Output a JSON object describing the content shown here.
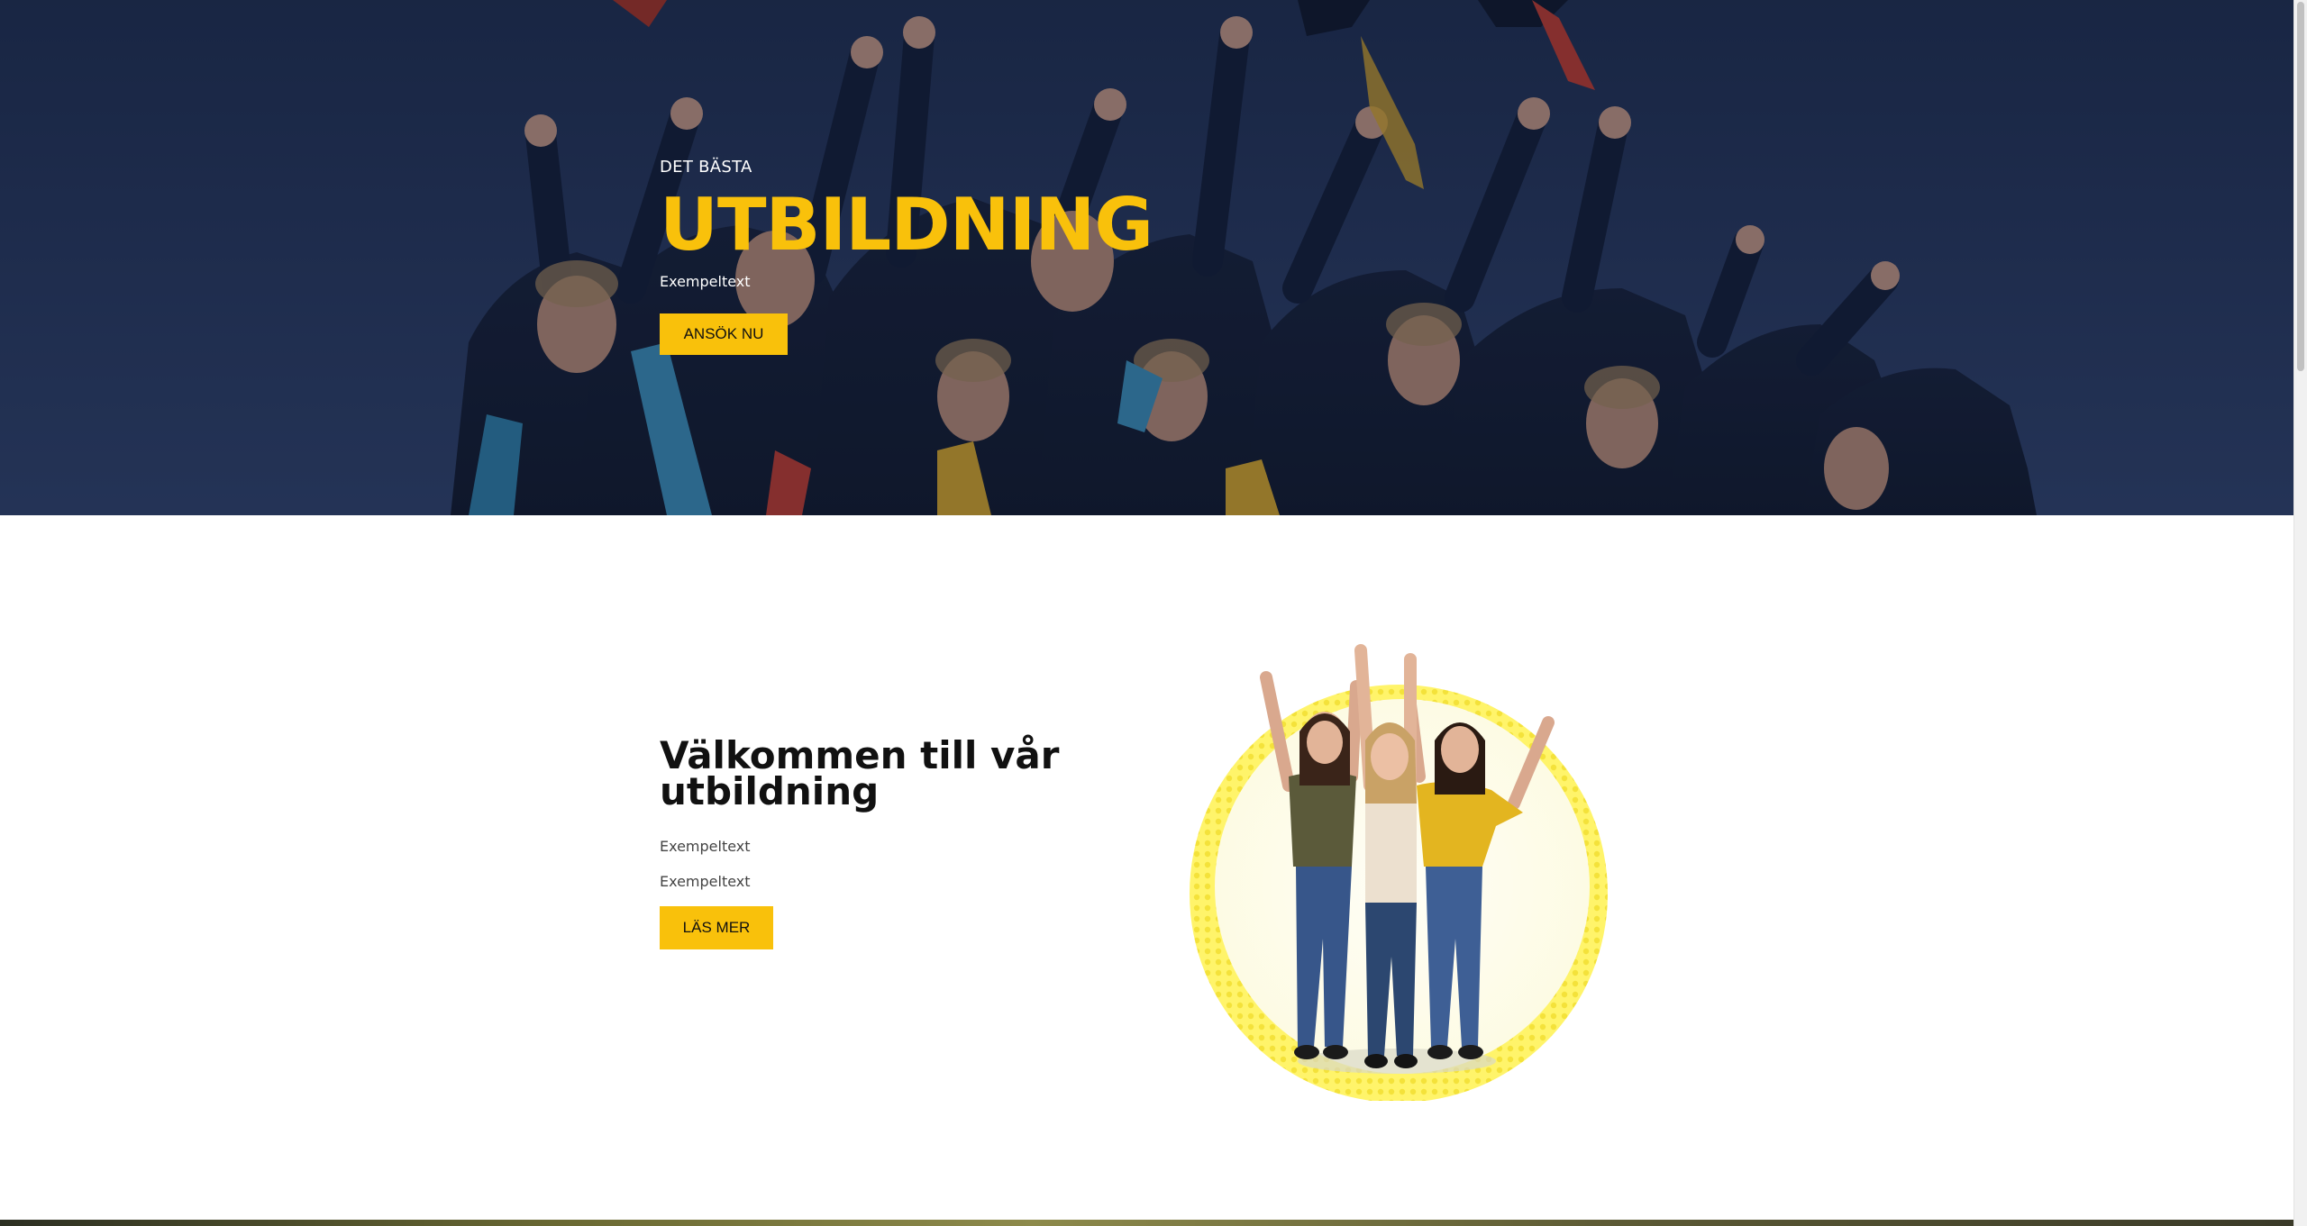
{
  "hero": {
    "eyebrow": "DET BÄSTA",
    "title": "UTBILDNING",
    "subtitle": "Exempeltext",
    "cta_label": "ANSÖK NU"
  },
  "welcome": {
    "title": "Välkommen till vår utbildning",
    "paragraphs": [
      "Exempeltext",
      "Exempeltext"
    ],
    "cta_label": "LÄS MER"
  },
  "colors": {
    "accent": "#f9c10b",
    "hero_bg": "#223454",
    "heading": "#111111",
    "body_text": "#444444"
  }
}
